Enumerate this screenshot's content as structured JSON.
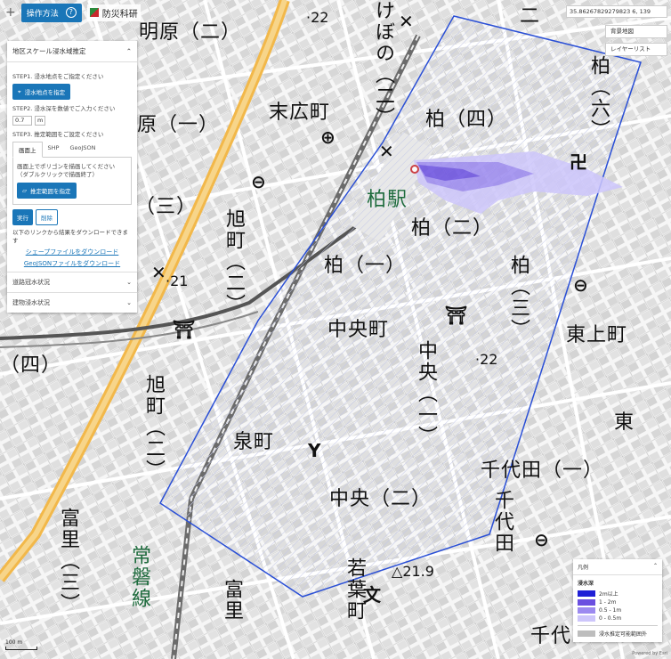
{
  "header": {
    "howto_label": "操作方法",
    "brand": "防災科研"
  },
  "panel": {
    "title": "地区スケール浸水域推定",
    "step1": "STEP1. 浸水地点をご指定ください",
    "step1_button": "浸水地点を指定",
    "step2": "STEP2. 浸水深を数値でご入力ください",
    "depth_value": "0.7",
    "depth_unit": "m",
    "step3": "STEP3. 推定範囲をご設定ください",
    "tabs": [
      "画面上",
      "SHP",
      "GeoJSON"
    ],
    "instruction_line1": "画面上でポリゴンを描画してください",
    "instruction_line2": "（ダブルクリックで描画終了）",
    "range_button": "推定範囲を指定",
    "run_button": "実行",
    "delete_button": "削除",
    "download_text": "以下のリンクから結果をダウンロードできます",
    "shp_link": "シェープファイルをダウンロード",
    "geojson_link": "GeoJSONファイルをダウンロード",
    "road_section": "道路冠水状況",
    "building_section": "建物浸水状況"
  },
  "top_right": {
    "coordinates": "35.86267829279823 6, 139",
    "base_map_button": "背景地図",
    "layer_list_button": "レイヤーリスト"
  },
  "legend": {
    "title": "凡例",
    "subtitle": "浸水深",
    "items": [
      {
        "label": "2m以上",
        "color": "#1f1fd6"
      },
      {
        "label": "1 - 2m",
        "color": "#6a4fe0"
      },
      {
        "label": "0.5 - 1m",
        "color": "#9c8af0"
      },
      {
        "label": "0 - 0.5m",
        "color": "#cdc6fb"
      }
    ],
    "outside_label": "浸水推定可能範囲外",
    "outside_color": "#bdbdbd"
  },
  "colors": {
    "polygon": "#2a4fd6",
    "major_road": "#f2b84a",
    "rail": "#6b6b6b"
  },
  "map": {
    "scale_label": "100 m",
    "copyright": "Powered by Esri",
    "places": {
      "akehara": "明原（二）",
      "suehiro": "末広町",
      "hara1": "原（一）",
      "kashiwa4": "柏（四）",
      "kashiwa6": "柏（六）",
      "kashiwa_station": "柏駅",
      "kashiwa2": "柏（二）",
      "kashiwa1": "柏（一）",
      "kashiwa3": "柏（三）",
      "chuocho": "中央町",
      "higashiue": "東上町",
      "chuo1": "中央（一）",
      "izumi": "泉町",
      "chuo2": "中央（二）",
      "chiyoda1": "千代田（一）",
      "chiyoda": "千代田",
      "wakaba": "若葉町",
      "tomisato_a": "富里（三）",
      "tomisato_b": "富里",
      "asahi2": "旭町（二）",
      "asahi_b": "旭町（二）",
      "shi4": "（四）",
      "kebono": "けぼの（二）",
      "joban": "常磐線",
      "higashi": "東",
      "chiyo": "千代",
      "san": "（三）",
      "ni_top": "二"
    },
    "elevations": [
      "22",
      "21",
      "22",
      "21.9"
    ]
  }
}
